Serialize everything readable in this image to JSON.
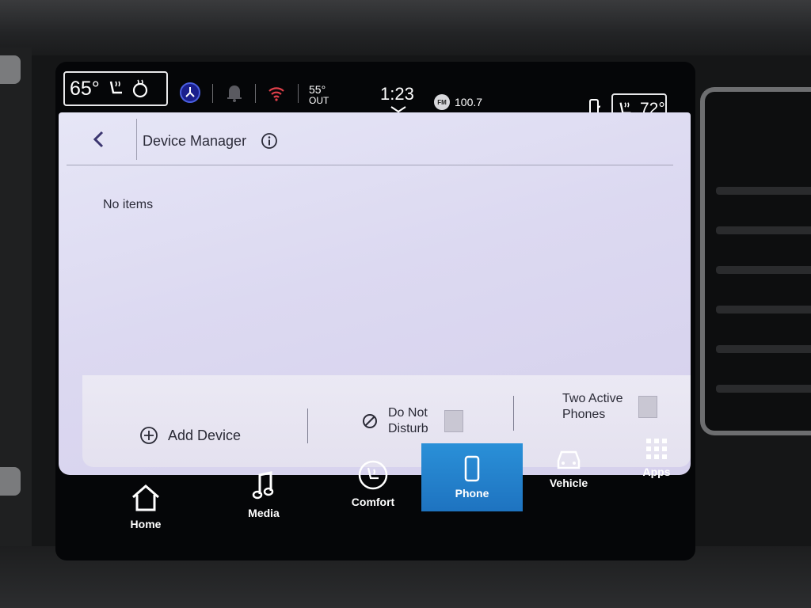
{
  "status": {
    "left_temp": "65°",
    "right_temp": "72°",
    "outside_temp": "55°",
    "outside_label": "OUT",
    "time": "1:23",
    "radio_band": "FM",
    "radio_freq": "100.7"
  },
  "header": {
    "title": "Device Manager"
  },
  "content": {
    "empty_message": "No items"
  },
  "actions": {
    "add_device": "Add Device",
    "do_not_disturb_line1": "Do Not",
    "do_not_disturb_line2": "Disturb",
    "two_active_line1": "Two Active",
    "two_active_line2": "Phones"
  },
  "nav": {
    "home": "Home",
    "media": "Media",
    "comfort": "Comfort",
    "phone": "Phone",
    "vehicle": "Vehicle",
    "apps": "Apps"
  },
  "colors": {
    "active_tab": "#1e73c0",
    "panel_bg": "#dcd9f1"
  }
}
